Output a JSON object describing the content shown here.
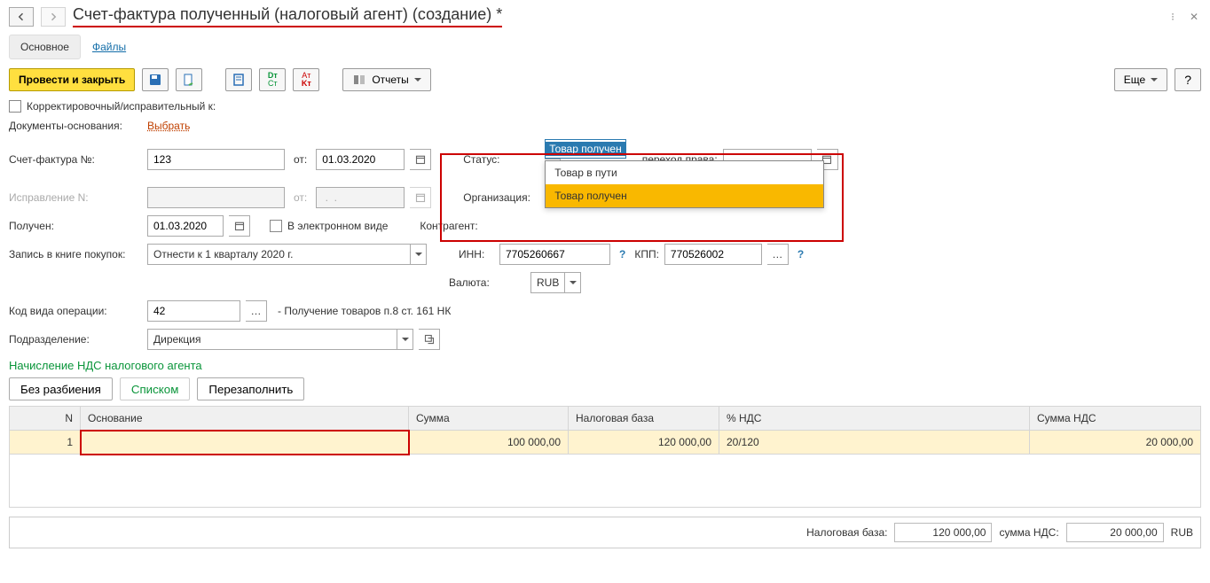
{
  "header": {
    "title": "Счет-фактура полученный (налоговый агент) (создание) *"
  },
  "tabs": {
    "main": "Основное",
    "files": "Файлы"
  },
  "toolbar": {
    "post_close": "Провести и закрыть",
    "reports": "Отчеты",
    "more": "Еще",
    "help": "?"
  },
  "form": {
    "corrective_label": "Корректировочный/исправительный к:",
    "basedoc_label": "Документы-основания:",
    "basedoc_link": "Выбрать",
    "num_label": "Счет-фактура №:",
    "num_value": "123",
    "from_label": "от:",
    "num_date": "01.03.2020",
    "corr_n_label": "Исправление N:",
    "corr_date": " .  .",
    "received_label": "Получен:",
    "received_date": "01.03.2020",
    "electronic_label": "В электронном виде",
    "book_label": "Запись в книге покупок:",
    "book_value": "Отнести к 1 кварталу 2020 г.",
    "opcode_label": "Код вида операции:",
    "opcode_value": "42",
    "opcode_text": "- Получение товаров п.8 ст. 161 НК",
    "subdiv_label": "Подразделение:",
    "subdiv_value": "Дирекция"
  },
  "right": {
    "status_label": "Статус:",
    "status_value": "Товар получен",
    "status_options": [
      "Товар в пути",
      "Товар получен"
    ],
    "transfer_label": "переход права:",
    "transfer_value": " .  .",
    "org_label": "Организация:",
    "ctr_label": "Контрагент:",
    "inn_label": "ИНН:",
    "inn_value": "7705260667",
    "kpp_label": "КПП:",
    "kpp_value": "770526002",
    "currency_label": "Валюта:",
    "currency_value": "RUB"
  },
  "section": {
    "title": "Начисление НДС налогового агента",
    "btn_split": "Без разбиения",
    "btn_list": "Списком",
    "btn_refill": "Перезаполнить"
  },
  "table": {
    "headers": {
      "n": "N",
      "base": "Основание",
      "sum": "Сумма",
      "nb": "Налоговая база",
      "rate": "% НДС",
      "vat": "Сумма НДС"
    },
    "row": {
      "n": "1",
      "base": "",
      "sum": "100 000,00",
      "nb": "120 000,00",
      "rate": "20/120",
      "vat": "20 000,00"
    }
  },
  "totals": {
    "nb_label": "Налоговая база:",
    "nb_value": "120 000,00",
    "vat_label": "сумма НДС:",
    "vat_value": "20 000,00",
    "currency": "RUB"
  }
}
